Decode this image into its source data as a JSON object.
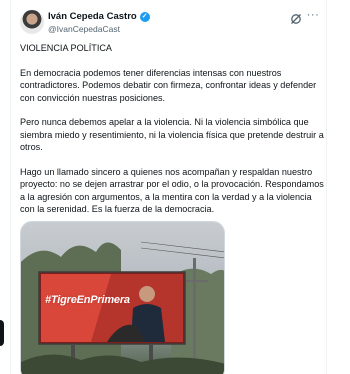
{
  "post": {
    "author_name": "Iván Cepeda Castro",
    "author_handle": "@IvanCepedaCast",
    "paragraphs": [
      "VIOLENCIA POLÍTICA",
      "En democracia podemos tener diferencias intensas con nuestros contradictores. Podemos debatir con firmeza, confrontar ideas y defender con convicción nuestras posiciones.",
      "Pero nunca debemos apelar a la violencia. Ni la violencia simbólica que siembra miedo y resentimiento, ni la violencia física que pretende destruir a otros.",
      "Hago un llamado sincero a quienes nos acompañan y respaldan nuestro proyecto: no se dejen arrastrar por el odio, o la provocación. Respondamos a la agresión con argumentos, a la mentira con la verdad y a la violencia con la serenidad. Es la fuerza de la democracia."
    ],
    "media": {
      "billboard_text": "#TigreEnPrimera"
    }
  },
  "icons": {
    "verified": "verified-badge-icon",
    "grok": "grok-icon",
    "more": "more-icon"
  },
  "colors": {
    "verified_blue": "#1d9bf0",
    "secondary_text": "#536471",
    "billboard_red": "#c0302a"
  }
}
